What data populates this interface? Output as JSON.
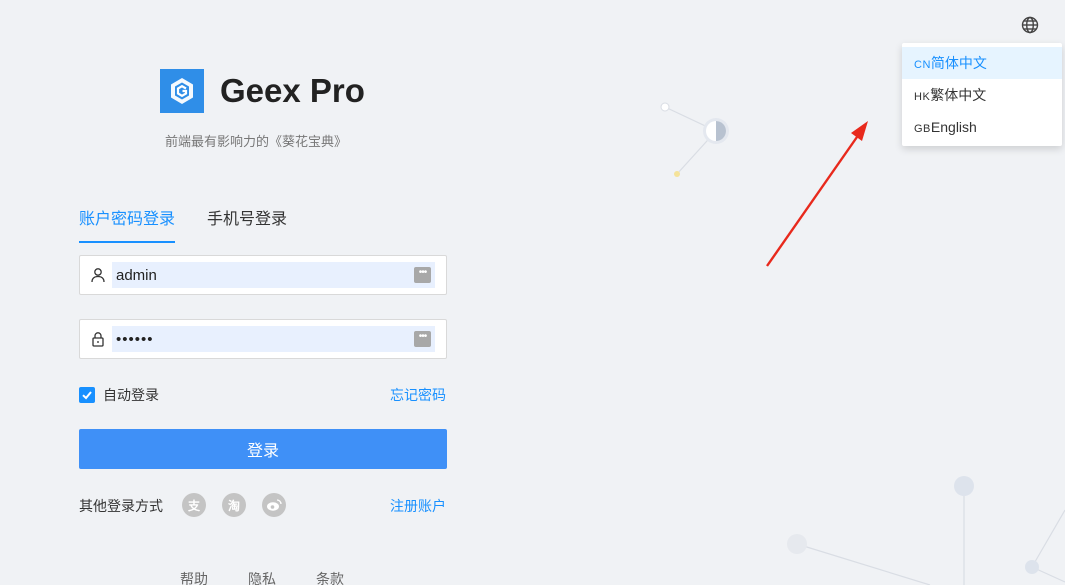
{
  "brand": {
    "title": "Geex Pro",
    "tagline": "前端最有影响力的《葵花宝典》"
  },
  "language_menu": {
    "items": [
      {
        "code": "CN",
        "label": "简体中文",
        "active": true
      },
      {
        "code": "HK",
        "label": "繁体中文",
        "active": false
      },
      {
        "code": "GB",
        "label": "English",
        "active": false
      }
    ]
  },
  "login": {
    "tabs": [
      {
        "label": "账户密码登录",
        "active": true
      },
      {
        "label": "手机号登录",
        "active": false
      }
    ],
    "username": "admin",
    "password_masked": "••••••",
    "remember_label": "自动登录",
    "remember_checked": true,
    "forgot_label": "忘记密码",
    "submit_label": "登录",
    "other_methods_label": "其他登录方式",
    "social": [
      {
        "icon": "alipay-icon",
        "glyph": "支"
      },
      {
        "icon": "taobao-icon",
        "glyph": "淘"
      },
      {
        "icon": "weibo-icon",
        "glyph": ""
      }
    ],
    "register_label": "注册账户"
  },
  "footer": {
    "links": [
      "帮助",
      "隐私",
      "条款"
    ]
  },
  "colors": {
    "primary": "#1890ff",
    "button": "#3f90f7",
    "background": "#f0f2f5",
    "arrow": "#e8291c"
  }
}
